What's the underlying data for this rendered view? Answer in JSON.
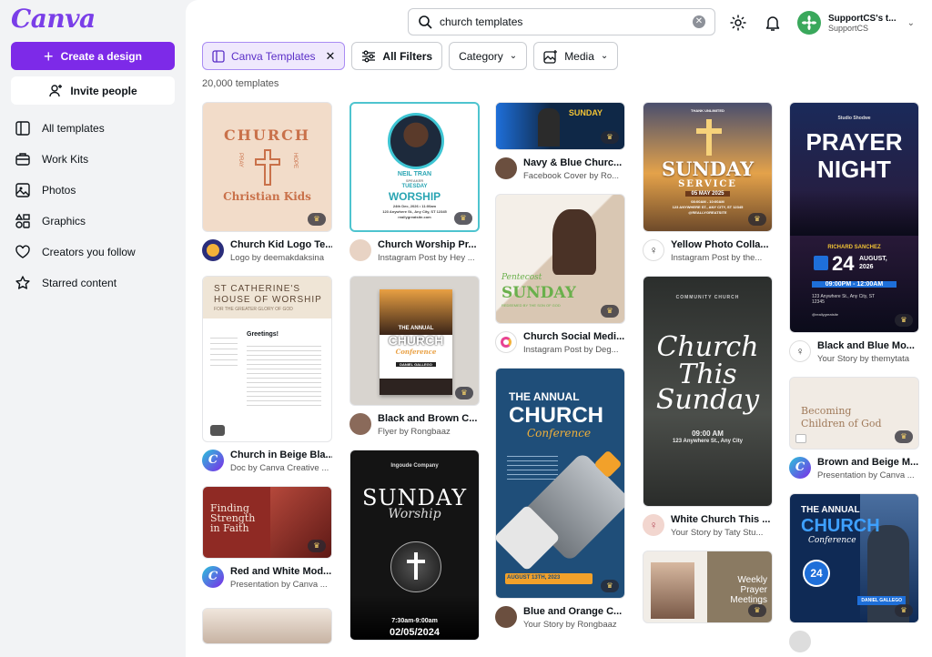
{
  "logo": "Canva",
  "sidebar": {
    "create_label": "Create a design",
    "invite_label": "Invite people",
    "items": [
      {
        "label": "All templates"
      },
      {
        "label": "Work Kits"
      },
      {
        "label": "Photos"
      },
      {
        "label": "Graphics"
      },
      {
        "label": "Creators you follow"
      },
      {
        "label": "Starred content"
      }
    ]
  },
  "search": {
    "value": "church templates",
    "placeholder": "Search"
  },
  "account": {
    "name": "SupportCS's t...",
    "team": "SupportCS"
  },
  "filters": {
    "active_chip": "Canva Templates",
    "all_filters": "All Filters",
    "category": "Category",
    "media": "Media"
  },
  "result_count": "20,000 templates",
  "cards": {
    "c1": {
      "title": "Church Kid Logo Te...",
      "sub": "Logo by deemakdaksina",
      "thumb_top": "CHURCH",
      "thumb_side_l": "PRAY",
      "thumb_side_r": "HOPE",
      "thumb_bottom": "Christian Kids"
    },
    "c2": {
      "title": "Church in Beige Bla...",
      "sub": "Doc by Canva Creative ...",
      "thumb_top": "ST CATHERINE'S",
      "thumb_top2": "HOUSE OF WORSHIP",
      "thumb_tag": "FOR THE GREATER GLORY OF GOD",
      "thumb_greet": "Greetings!"
    },
    "c3": {
      "title": "Red and White Mod...",
      "sub": "Presentation by Canva ...",
      "thumb_text": "Finding Strength in Faith"
    },
    "c4": {
      "title": "Church Worship Pr...",
      "sub": "Instagram Post by Hey ...",
      "thumb_name": "NEIL TRAN",
      "thumb_role": "SPEAKER",
      "thumb_day": "TUESDAY",
      "thumb_title": "WORSHIP",
      "thumb_date": "24th Dec, 2026 • 11:00am",
      "thumb_addr": "123 Anywhere St., Any City, ST 12345",
      "thumb_site": "reallygreatsite.com"
    },
    "c5": {
      "title": "Black and Brown C...",
      "sub": "Flyer by Rongbaaz",
      "thumb_line1": "THE ANNUAL",
      "thumb_line2": "CHURCH",
      "thumb_line3": "Conference",
      "thumb_name": "DANIEL GALLEGO"
    },
    "c6": {
      "thumb_company": "Ingoude Company",
      "thumb_line1": "SUNDAY",
      "thumb_line2": "Worship",
      "thumb_time": "7:30am-9:00am",
      "thumb_date": "02/05/2024"
    },
    "c7": {
      "title": "Navy & Blue Churc...",
      "sub": "Facebook Cover by Ro...",
      "thumb_text": "SUNDAY"
    },
    "c8": {
      "title": "Church Social Medi...",
      "sub": "Instagram Post by Deg...",
      "thumb_line1": "Pentecost",
      "thumb_line2": "SUNDAY",
      "thumb_tag": "REDEEMED BY THE SON OF GOD"
    },
    "c9": {
      "title": "Blue and Orange C...",
      "sub": "Your Story by Rongbaaz",
      "thumb_line1": "THE ANNUAL",
      "thumb_line2": "CHURCH",
      "thumb_line3": "Conference",
      "thumb_date": "AUGUST 13TH, 2023"
    },
    "c10": {
      "title": "Yellow Photo Colla...",
      "sub": "Instagram Post by the...",
      "thumb_top": "THANK UNLIMITED",
      "thumb_line1": "SUNDAY",
      "thumb_line2": "SERVICE",
      "thumb_date": "05 MAY 2025",
      "thumb_time": "08:00AM - 10:00AM",
      "thumb_addr": "123 ANYWHERE ST., ANY CITY, ST 12345",
      "thumb_site": "@REALLYGREATSITE"
    },
    "c11": {
      "title": "White Church This ...",
      "sub": "Your Story by Taty Stu...",
      "thumb_top": "COMMUNITY CHURCH",
      "thumb_line1": "Church",
      "thumb_line2": "This",
      "thumb_line3": "Sunday",
      "thumb_time": "09:00 AM",
      "thumb_addr": "123 Anywhere St., Any City"
    },
    "c12": {
      "thumb_line1": "Weekly",
      "thumb_line2": "Prayer",
      "thumb_line3": "Meetings"
    },
    "c13": {
      "title": "Black and Blue Mo...",
      "sub": "Your Story by themytata",
      "thumb_top": "Studio Shodwe",
      "thumb_line1": "PRAYER",
      "thumb_line2": "NIGHT",
      "thumb_name": "RICHARD SANCHEZ",
      "thumb_day": "24",
      "thumb_month": "AUGUST,",
      "thumb_year": "2026",
      "thumb_time": "09:00PM - 12:00AM",
      "thumb_addr": "123 Anywhere St., Any City, ST 12345",
      "thumb_site": "@reallygreatsite"
    },
    "c14": {
      "title": "Brown and Beige M...",
      "sub": "Presentation by Canva ...",
      "thumb_line1": "Becoming",
      "thumb_line2": "Children of God"
    },
    "c15": {
      "thumb_line1": "THE ANNUAL",
      "thumb_line2": "CHURCH",
      "thumb_line3": "Conference",
      "thumb_day": "24",
      "thumb_name": "DANIEL GALLEGO"
    }
  }
}
